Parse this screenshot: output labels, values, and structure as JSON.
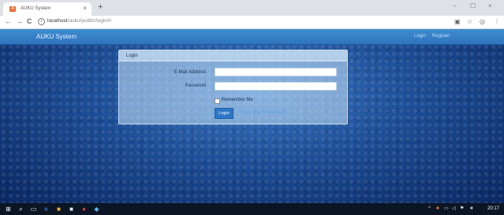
{
  "browser": {
    "tab_title": "AUKU System",
    "tab_close": "×",
    "new_tab": "+",
    "window_controls": {
      "minimize": "−",
      "maximize": "☐",
      "close": "×"
    },
    "nav": {
      "back": "←",
      "forward": "→",
      "reload": "C"
    },
    "url_host": "localhost",
    "url_path": "/auku/public/login#/",
    "toolbar_icons": {
      "translate": "▣",
      "bookmark": "☆",
      "account": "◎",
      "menu": "⋮"
    }
  },
  "app": {
    "brand": "AUKU System",
    "nav_login": "Login",
    "nav_register": "Register"
  },
  "login": {
    "header": "Login",
    "email_label": "E-Mail Address",
    "email_value": "",
    "password_label": "Password",
    "password_value": "",
    "remember_label": "Remember Me",
    "remember_checked": false,
    "submit_label": "Login",
    "forgot_link": "Forgot Your Password?"
  },
  "taskbar": {
    "start": "⊞",
    "search": "⌕",
    "task_view": "▭",
    "pinned": [
      {
        "name": "edge",
        "glyph": "e",
        "color": "#2f8ee8"
      },
      {
        "name": "explorer",
        "glyph": "■",
        "color": "#e6b33a"
      },
      {
        "name": "store",
        "glyph": "■",
        "color": "#dfe6ee"
      },
      {
        "name": "chrome",
        "glyph": "●",
        "color": "#d9463b"
      },
      {
        "name": "app",
        "glyph": "◆",
        "color": "#58b5e6"
      }
    ],
    "tray": {
      "chevron": "^",
      "app": "■",
      "network": "▭",
      "volume": "◁",
      "flag": "⚑"
    },
    "clock": "20:17"
  }
}
